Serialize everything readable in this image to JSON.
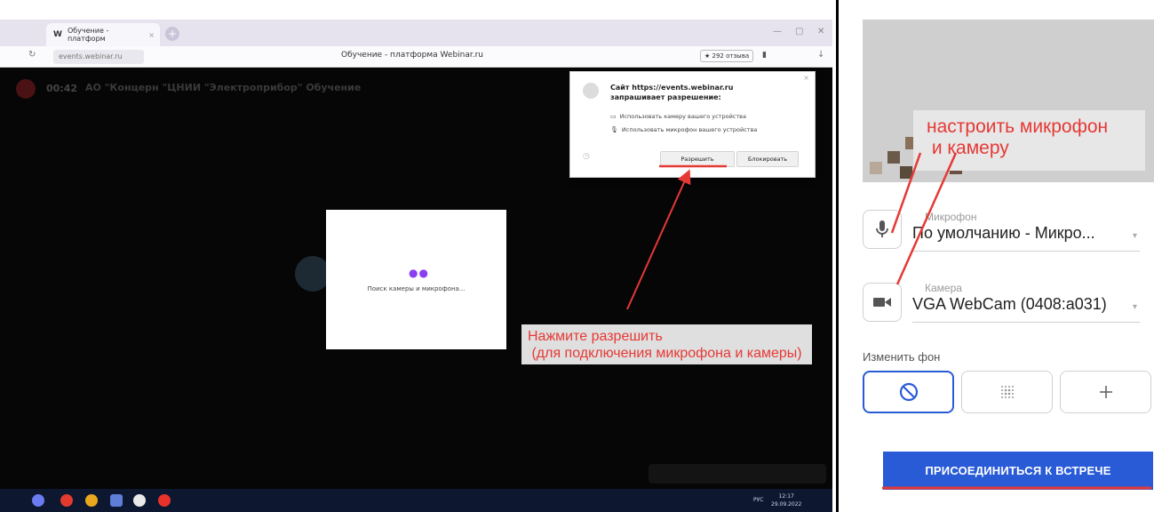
{
  "browser": {
    "tab_title": "Обучение - платформ",
    "url": "events.webinar.ru",
    "page_title": "Обучение - платформа Webinar.ru",
    "reviews": "★ 292 отзыва"
  },
  "webinar": {
    "timer": "00:42",
    "title": "АО \"Концерн \"ЦНИИ \"Электроприбор\"   Обучение",
    "searching_text": "Поиск камеры и микрофона..."
  },
  "permission_popup": {
    "site_line": "Сайт https://events.webinar.ru",
    "request_line": "запрашивает разрешение:",
    "camera_item": "Использовать камеру вашего устройства",
    "mic_item": "Использовать микрофон вашего устройства",
    "allow_label": "Разрешить",
    "block_label": "Блокировать"
  },
  "taskbar": {
    "lang": "РУС",
    "time": "12:17",
    "date": "29.09.2022"
  },
  "annotations": {
    "left_callout": "Нажмите разрешить\n (для подключения микрофона и камеры)",
    "right_callout": "настроить микрофон\n и камеру"
  },
  "panel": {
    "microphone_label": "Микрофон",
    "microphone_value": "По умолчанию - Микро...",
    "camera_label": "Камера",
    "camera_value": "VGA WebCam (0408:a031)",
    "background_label": "Изменить фон",
    "join_label": "ПРИСОЕДИНИТЬСЯ К ВСТРЕЧЕ"
  },
  "colors": {
    "accent_blue": "#2a5bd7",
    "annotation_red": "#e53935"
  }
}
